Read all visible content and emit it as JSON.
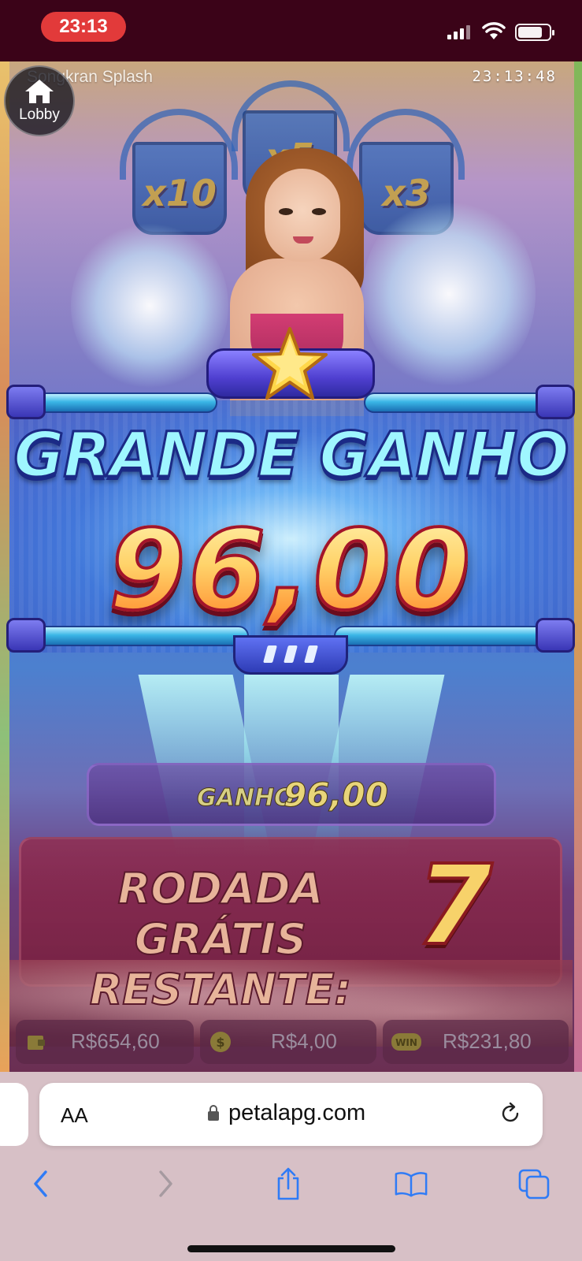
{
  "status_bar": {
    "time": "23:13",
    "icons": [
      "signal-icon",
      "wifi-icon",
      "battery-icon"
    ]
  },
  "game": {
    "title": "Songkran Splash",
    "clock": "23:13:48",
    "lobby_label": "Lobby",
    "multipliers": [
      "x10",
      "x5",
      "x3"
    ],
    "big_win_title": "GRANDE GANHO",
    "big_win_amount": "96,00",
    "spin_win_label": "GANHO",
    "spin_win_value": "96,00",
    "free_spins_label_line1": "RODADA GRÁTIS",
    "free_spins_label_line2": "RESTANTE:",
    "free_spins_remaining": "7",
    "balance": "R$654,60",
    "bet": "R$4,00",
    "win_total": "R$231,80",
    "win_icon_text": "WIN"
  },
  "browser": {
    "text_size_label": "AA",
    "url": "petalapg.com",
    "toolbar_icons": [
      "back-icon",
      "forward-icon",
      "share-icon",
      "bookmarks-icon",
      "tabs-icon"
    ]
  },
  "colors": {
    "status_bar_bg": "#3b0318",
    "time_pill": "#e23a3a",
    "browser_bg": "#d7c0c6",
    "toolbar_icon_active": "#2f7bf6",
    "toolbar_icon_inactive": "#a69aa0"
  }
}
